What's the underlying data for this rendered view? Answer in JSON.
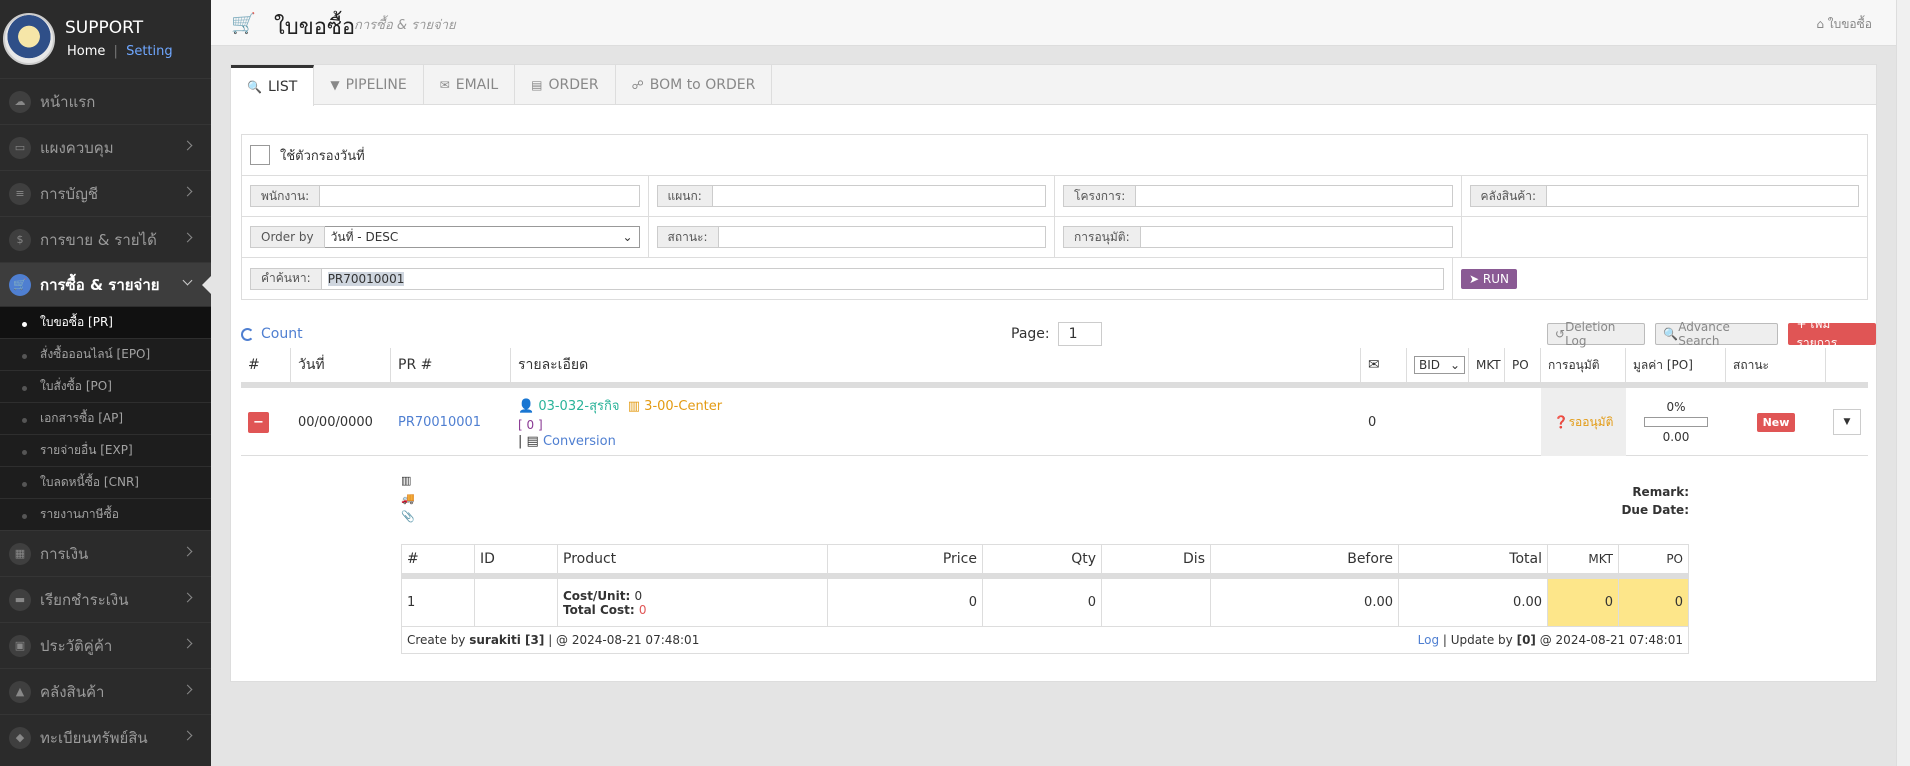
{
  "sidebar": {
    "brand": "SUPPORT",
    "home": "Home",
    "sep": "|",
    "setting": "Setting",
    "items": [
      {
        "label": "หน้าแรก",
        "icon": "cloud-icon"
      },
      {
        "label": "แผงควบคุม",
        "icon": "monitor-icon"
      },
      {
        "label": "การบัญชี",
        "icon": "database-icon"
      },
      {
        "label": "การขาย & รายได้",
        "icon": "dollar-icon"
      },
      {
        "label": "การซื้อ & รายจ่าย",
        "icon": "cart-icon"
      }
    ],
    "sub_items": [
      "ใบขอซื้อ [PR]",
      "สั่งซื้อออนไลน์ [EPO]",
      "ใบสั่งซื้อ [PO]",
      "เอกสารซื้อ [AP]",
      "รายจ่ายอื่น [EXP]",
      "ใบลดหนี้ซื้อ [CNR]",
      "รายงานภาษีซื้อ"
    ],
    "items_after": [
      {
        "label": "การเงิน",
        "icon": "calendar-icon"
      },
      {
        "label": "เรียกชำระเงิน",
        "icon": "credit-card-icon"
      },
      {
        "label": "ประวัติคู่ค้า",
        "icon": "contact-icon"
      },
      {
        "label": "คลังสินค้า",
        "icon": "cubes-icon"
      },
      {
        "label": "ทะเบียนทรัพย์สิน",
        "icon": "diamond-icon"
      }
    ]
  },
  "header": {
    "title": "ใบขอซื้อ",
    "subtitle": "การซื้อ & รายจ่าย",
    "breadcrumb": "ใบขอซื้อ"
  },
  "tabs": [
    "LIST",
    "PIPELINE",
    "EMAIL",
    "ORDER",
    "BOM to ORDER"
  ],
  "filter": {
    "date_filter_label": "ใช้ตัวกรองวันที่",
    "employee_label": "พนักงาน:",
    "department_label": "แผนก:",
    "project_label": "โครงการ:",
    "warehouse_label": "คลังสินค้า:",
    "orderby_label": "Order by",
    "orderby_value": "วันที่ - DESC",
    "status_label": "สถานะ:",
    "approval_label": "การอนุมัติ:",
    "search_label": "คำค้นหา:",
    "search_value": "PR70010001",
    "run_label": "RUN"
  },
  "controls": {
    "count": "Count",
    "page_label": "Page:",
    "page_value": "1",
    "deletion_log": "Deletion Log",
    "advance_search": "Advance Search",
    "add_item": "+ เพิ่มรายการ"
  },
  "table": {
    "headers": {
      "num": "#",
      "date": "วันที่",
      "pr": "PR #",
      "desc": "รายละเอียด",
      "bid": "BID",
      "mkt": "MKT",
      "po": "PO",
      "approval": "การอนุมัติ",
      "value": "มูลค่า [PO]",
      "status": "สถานะ"
    },
    "row": {
      "date": "00/00/0000",
      "pr": "PR70010001",
      "employee": "03-032-สุรกิจ",
      "center": "3-00-Center",
      "count": "[ 0 ]",
      "conv_prefix": "|",
      "conversion": "Conversion",
      "mail_count": "0",
      "approval": "รออนุมัติ",
      "percent": "0%",
      "value": "0.00",
      "status": "New",
      "progress": 0
    }
  },
  "detail": {
    "remark_label": "Remark:",
    "due_label": "Due Date:",
    "headers": [
      "#",
      "ID",
      "Product",
      "Price",
      "Qty",
      "Dis",
      "Before",
      "Total",
      "MKT",
      "PO"
    ],
    "row": {
      "num": "1",
      "cost_unit_label": "Cost/Unit:",
      "cost_unit": "0",
      "total_cost_label": "Total Cost:",
      "total_cost": "0",
      "price": "0",
      "qty": "0",
      "before": "0.00",
      "total": "0.00",
      "mkt": "0",
      "po": "0"
    },
    "footer": {
      "create_prefix": "Create by",
      "create_user": "surakiti [3]",
      "create_time": "| @ 2024-08-21 07:48:01",
      "log": "Log",
      "update_prefix": "| Update by",
      "update_user": "[0]",
      "update_time": "@ 2024-08-21 07:48:01"
    }
  },
  "colors": {
    "accent": "#4f7fd1",
    "danger": "#e05555",
    "run": "#8a5a94",
    "teal": "#2bb39a",
    "orange": "#e39b14",
    "highlight": "#fde68a"
  }
}
